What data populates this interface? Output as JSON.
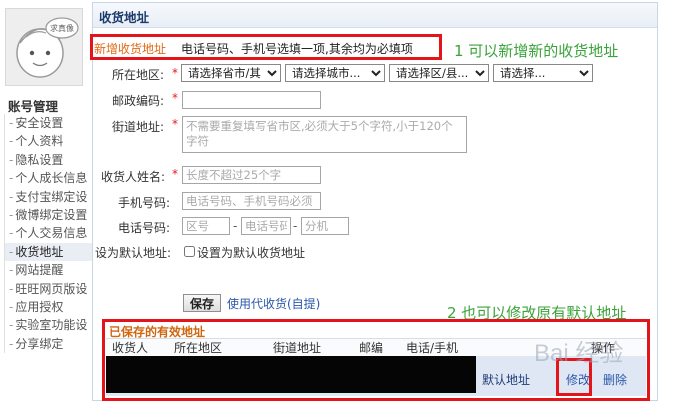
{
  "sidebar": {
    "avatar_text": "求真像",
    "section_title": "账号管理",
    "items": [
      {
        "label": "安全设置",
        "active": false
      },
      {
        "label": "个人资料",
        "active": false
      },
      {
        "label": "隐私设置",
        "active": false
      },
      {
        "label": "个人成长信息",
        "active": false
      },
      {
        "label": "支付宝绑定设",
        "active": false
      },
      {
        "label": "微博绑定设置",
        "active": false
      },
      {
        "label": "个人交易信息",
        "active": false
      },
      {
        "label": "收货地址",
        "active": true
      },
      {
        "label": "网站提醒",
        "active": false
      },
      {
        "label": "旺旺网页版设",
        "active": false
      },
      {
        "label": "应用授权",
        "active": false
      },
      {
        "label": "实验室功能设",
        "active": false
      },
      {
        "label": "分享绑定",
        "active": false
      }
    ]
  },
  "main": {
    "title": "收货地址",
    "new_address_label": "新增收货地址",
    "new_address_tip": "电话号码、手机号选填一项,其余均为必填项",
    "annotation_1": "1 可以新增新的收货地址",
    "annotation_2": "2 也可以修改原有默认地址",
    "form": {
      "region_label": "所在地区:",
      "required_mark": "*",
      "province_select": "请选择省市/其",
      "city_select": "请选择城市...",
      "district_select": "请选择区/县...",
      "street_select": "请选择...",
      "postcode_label": "邮政编码:",
      "postcode_value": "",
      "street_label": "街道地址:",
      "street_placeholder": "不需要重复填写省市区,必须大于5个字符,小于120个字符",
      "name_label": "收货人姓名:",
      "name_placeholder": "长度不超过25个字",
      "mobile_label": "手机号码:",
      "mobile_placeholder": "电话号码、手机号码必须",
      "phone_label": "电话号码:",
      "phone_area_placeholder": "区号",
      "phone_number_placeholder": "电话号码",
      "phone_ext_placeholder": "分机",
      "phone_dash": "-",
      "default_label": "设为默认地址:",
      "default_checkbox_label": "设置为默认收货地址",
      "save_button": "保存",
      "agent_link": "使用代收货(自提)"
    },
    "saved": {
      "title": "已保存的有效地址",
      "columns": [
        "收货人",
        "所在地区",
        "街道地址",
        "邮编",
        "电话/手机",
        "操作"
      ],
      "row": {
        "default_tag": "默认地址",
        "edit_label": "修改",
        "delete_label": "删除"
      }
    },
    "watermark": "Bai 经验"
  },
  "colors": {
    "highlight_red": "#e3151a",
    "annotation_green": "#3aa33a",
    "link_blue": "#2a58a8",
    "header_orange": "#d0670f"
  }
}
